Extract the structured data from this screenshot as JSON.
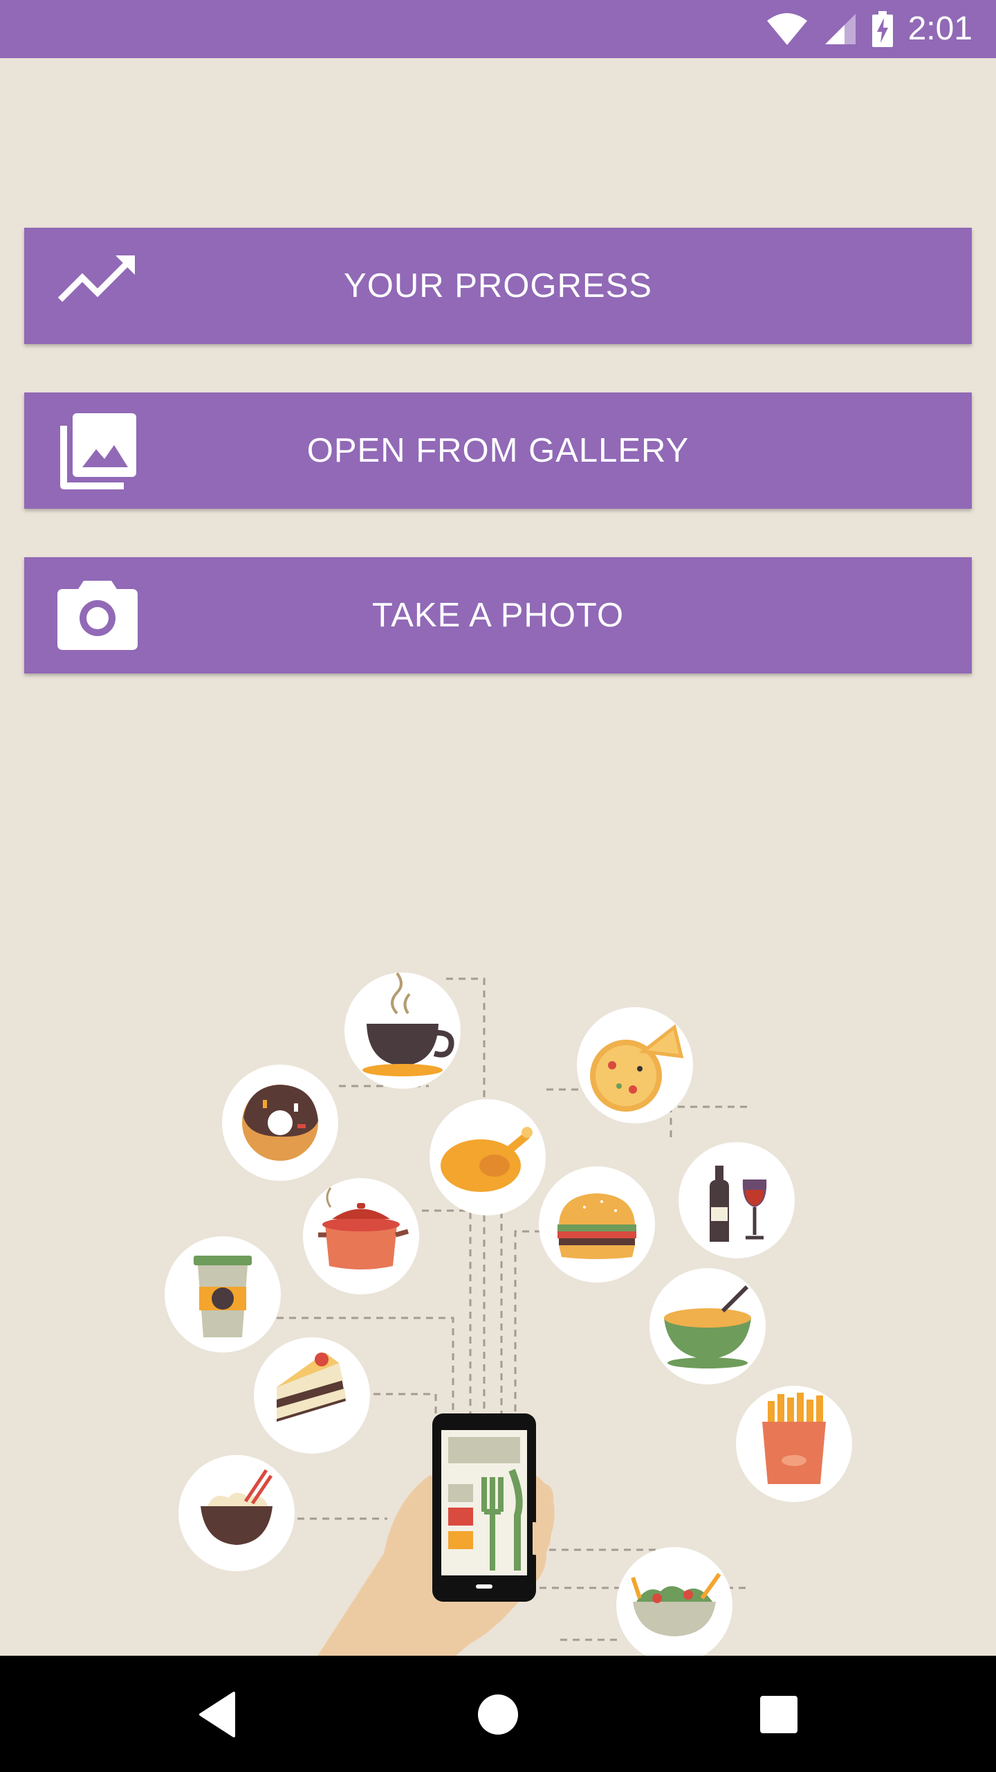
{
  "status_bar": {
    "time": "2:01",
    "icons": [
      "wifi-icon",
      "cellular-signal-icon",
      "battery-charging-icon"
    ]
  },
  "buttons": {
    "progress": {
      "label": "YOUR PROGRESS",
      "icon": "trending-up-icon"
    },
    "gallery": {
      "label": "OPEN FROM GALLERY",
      "icon": "photo-library-icon"
    },
    "camera": {
      "label": "TAKE A PHOTO",
      "icon": "camera-icon"
    }
  },
  "illustration": {
    "items": [
      "coffee-cup-icon",
      "pizza-icon",
      "donut-icon",
      "roast-chicken-icon",
      "wine-icon",
      "cooking-pot-icon",
      "burger-icon",
      "coffee-to-go-icon",
      "soup-bowl-icon",
      "cake-slice-icon",
      "french-fries-icon",
      "noodle-bowl-icon",
      "salad-bowl-icon",
      "smartphone-in-hand-icon"
    ]
  },
  "nav_bar": {
    "icons": [
      "back-icon",
      "home-icon",
      "recents-icon"
    ]
  },
  "colors": {
    "accent": "#9169B6",
    "background": "#EAE3D8",
    "nav_background": "#000000"
  }
}
